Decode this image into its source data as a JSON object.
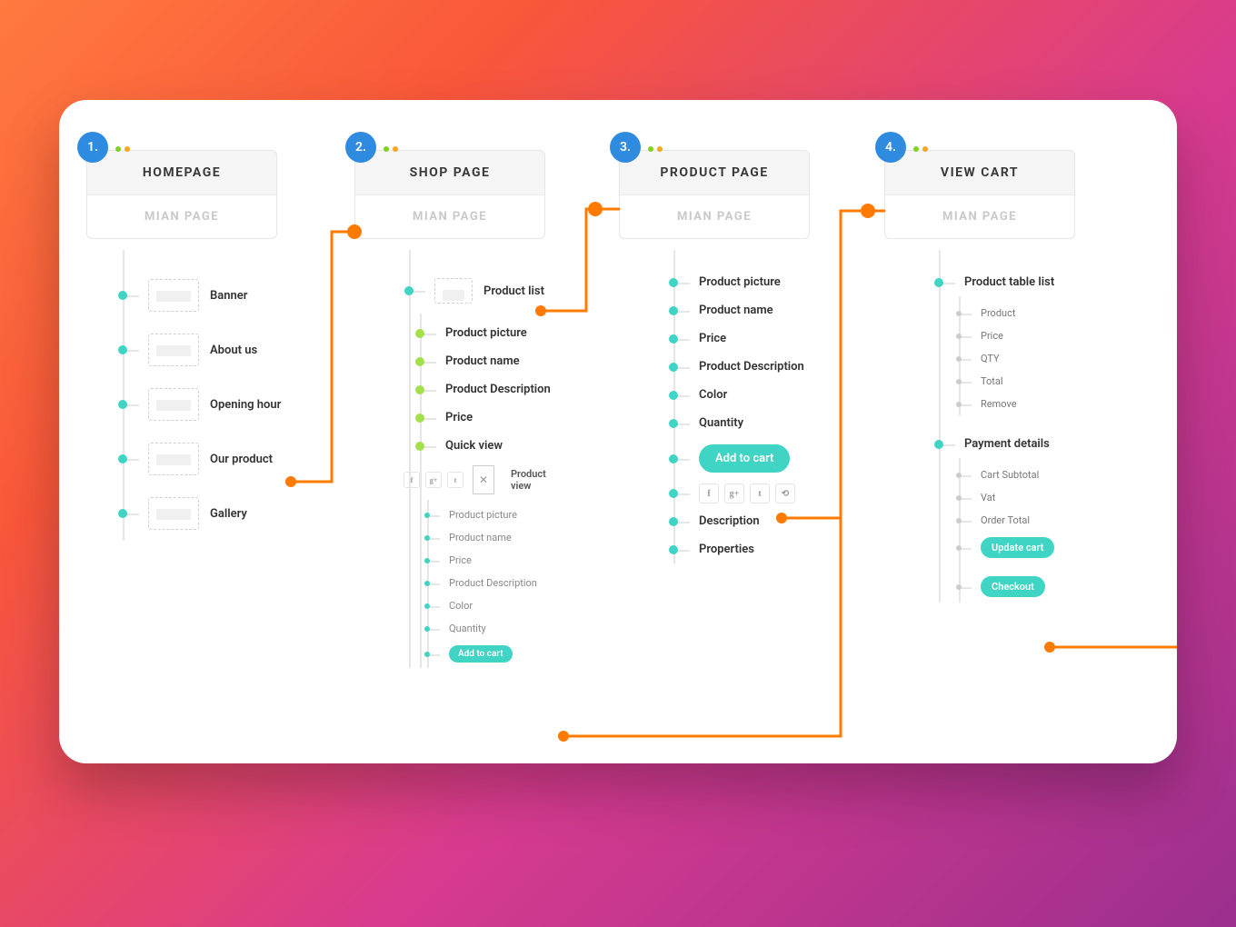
{
  "columns": {
    "c1": {
      "num": "1.",
      "title": "HOMEPAGE",
      "sub": "MIAN PAGE",
      "items": {
        "banner": "Banner",
        "about": "About us",
        "hours": "Opening hour",
        "product": "Our product",
        "gallery": "Gallery"
      }
    },
    "c2": {
      "num": "2.",
      "title": "SHOP PAGE",
      "sub": "MIAN PAGE",
      "list_label": "Product list",
      "items": {
        "pic": "Product picture",
        "name": "Product name",
        "desc": "Product Description",
        "price": "Price",
        "quick": "Quick view"
      },
      "quickview": {
        "view_label": "Product view",
        "sub": {
          "pic": "Product picture",
          "name": "Product name",
          "price": "Price",
          "desc": "Product Description",
          "color": "Color",
          "qty": "Quantity",
          "add": "Add to cart"
        }
      }
    },
    "c3": {
      "num": "3.",
      "title": "PRODUCT PAGE",
      "sub": "MIAN PAGE",
      "items": {
        "pic": "Product picture",
        "name": "Product name",
        "price": "Price",
        "desc": "Product Description",
        "color": "Color",
        "qty": "Quantity",
        "add": "Add to cart",
        "desc2": "Description",
        "props": "Properties"
      }
    },
    "c4": {
      "num": "4.",
      "title": "VIEW CART",
      "sub": "MIAN PAGE",
      "table_label": "Product table list",
      "table": {
        "product": "Product",
        "price": "Price",
        "qty": "QTY",
        "total": "Total",
        "remove": "Remove"
      },
      "payment_label": "Payment details",
      "payment": {
        "subtotal": "Cart Subtotal",
        "vat": "Vat",
        "order_total": "Order Total",
        "update": "Update cart",
        "checkout": "Checkout"
      }
    }
  },
  "social_icons": {
    "fb": "f",
    "gp": "g+",
    "tw": "t",
    "sh": "⟲"
  }
}
